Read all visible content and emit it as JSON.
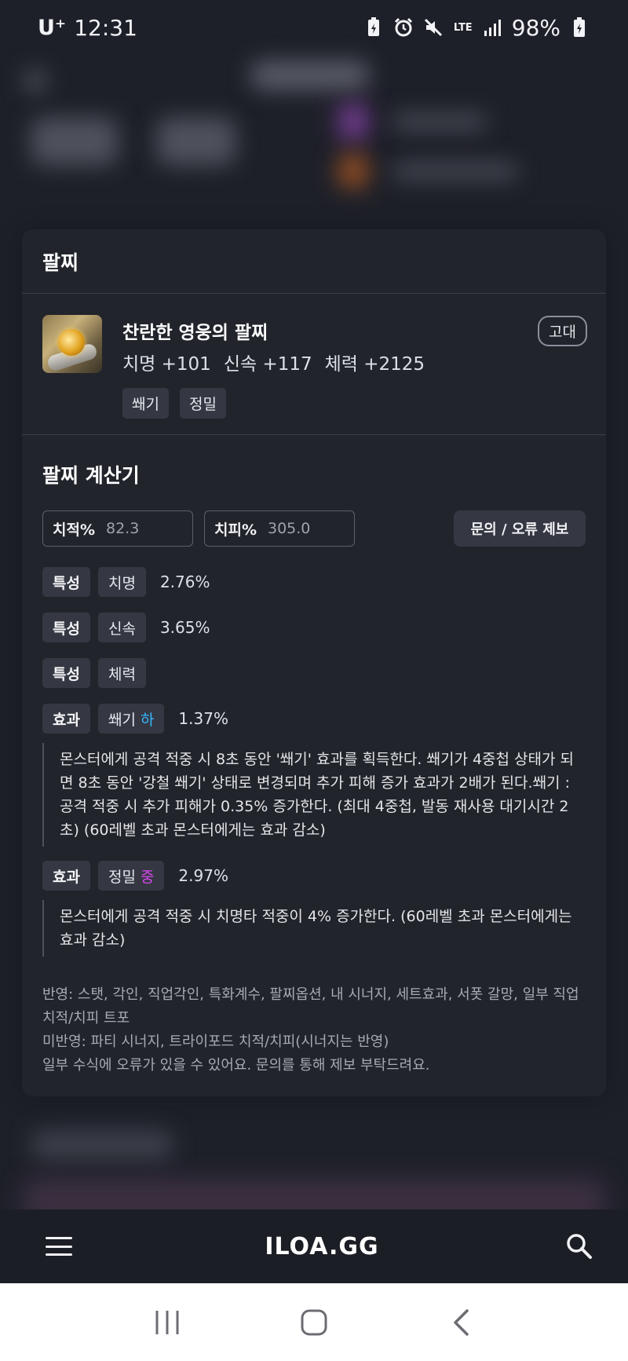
{
  "status_bar": {
    "carrier": "U⁺",
    "time": "12:31",
    "network": "LTE",
    "battery": "98%"
  },
  "bracelet_section": {
    "title": "팔찌",
    "item": {
      "name": "찬란한 영웅의 팔찌",
      "grade": "고대",
      "stats": [
        "치명 +101",
        "신속 +117",
        "체력 +2125"
      ],
      "tags": [
        "쐐기",
        "정밀"
      ]
    }
  },
  "calculator": {
    "title": "팔찌 계산기",
    "crit_rate": {
      "label": "치적%",
      "value": "82.3"
    },
    "crit_damage": {
      "label": "치피%",
      "value": "305.0"
    },
    "report_button": "문의 / 오류 제보",
    "rows": [
      {
        "type": "특성",
        "name": "치명",
        "value": "2.76%"
      },
      {
        "type": "특성",
        "name": "신속",
        "value": "3.65%"
      },
      {
        "type": "특성",
        "name": "체력",
        "value": ""
      }
    ],
    "effects": [
      {
        "type": "효과",
        "name": "쐐기",
        "level": "하",
        "value": "1.37%",
        "description": "몬스터에게 공격 적중 시 8초 동안 '쐐기' 효과를 획득한다. 쐐기가 4중첩 상태가 되면 8초 동안 '강철 쐐기' 상태로 변경되며 추가 피해 증가 효과가 2배가 된다.쐐기 : 공격 적중 시 추가 피해가 0.35% 증가한다. (최대 4중첩, 발동 재사용 대기시간 2초) (60레벨 초과 몬스터에게는 효과 감소)"
      },
      {
        "type": "효과",
        "name": "정밀",
        "level": "중",
        "value": "2.97%",
        "description": "몬스터에게 공격 적중 시 치명타 적중이 4% 증가한다. (60레벨 초과 몬스터에게는 효과 감소)"
      }
    ],
    "notes": [
      "반영: 스탯, 각인, 직업각인, 특화계수, 팔찌옵션, 내 시너지, 세트효과, 서폿 갈망, 일부 직업 치적/치피 트포",
      "미반영: 파티 시너지, 트라이포드 치적/치피(시너지는 반영)",
      "일부 수식에 오류가 있을 수 있어요. 문의를 통해 제보 부탁드려요."
    ]
  },
  "bottom_nav": {
    "brand": "ILOA.GG",
    "menu_icon": "menu-icon",
    "search_icon": "search-icon"
  },
  "system_nav": {
    "recent_icon": "recent-apps-icon",
    "home_icon": "home-icon",
    "back_icon": "back-icon"
  },
  "colors": {
    "background": "#1c1e25",
    "card": "#22242c",
    "chip": "#353842",
    "level_low": "#38b6ff",
    "level_mid": "#d946ef"
  }
}
